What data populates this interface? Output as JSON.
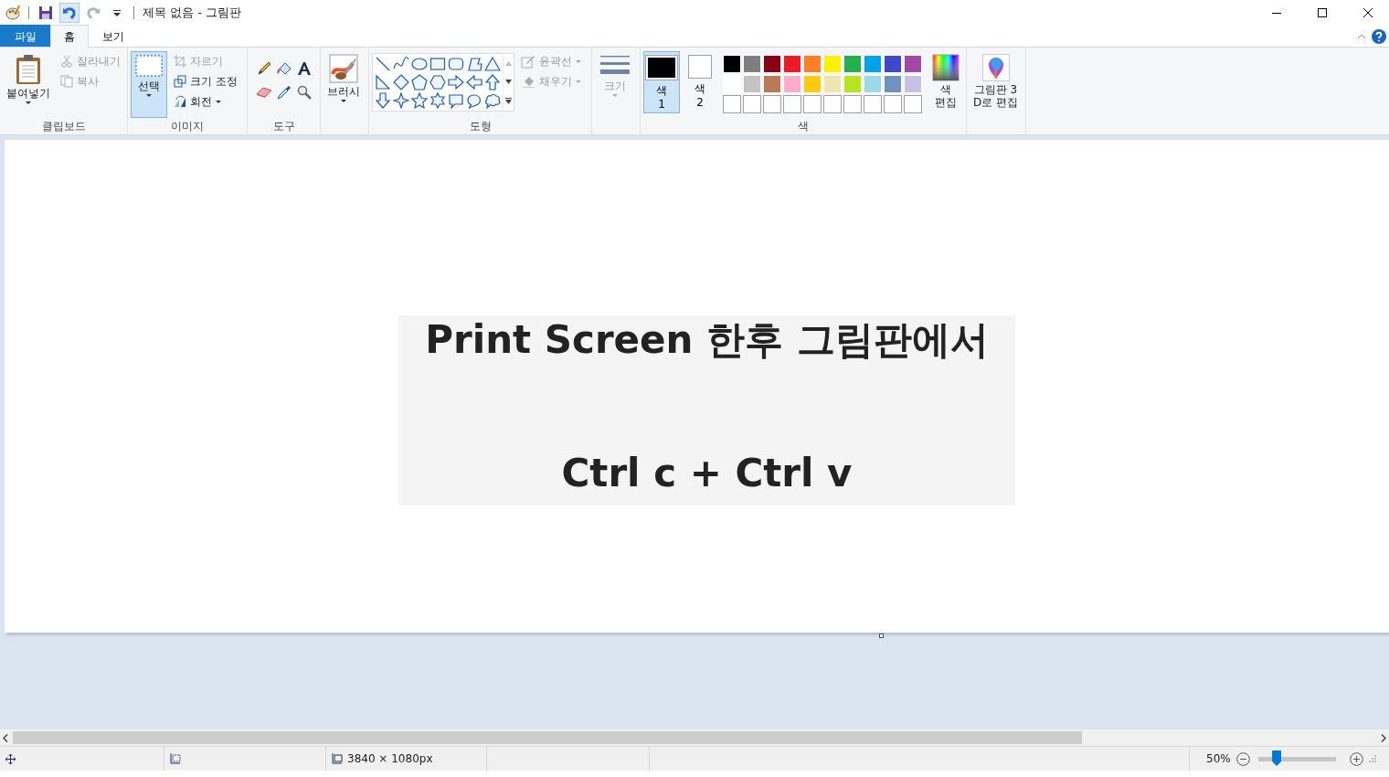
{
  "window": {
    "title": "제목 없음 - 그림판"
  },
  "tabs": [
    {
      "label": "파일",
      "kind": "file",
      "selected": false
    },
    {
      "label": "홈",
      "kind": "tab",
      "selected": true
    },
    {
      "label": "보기",
      "kind": "tab",
      "selected": false
    }
  ],
  "ribbon": {
    "clipboard": {
      "label": "클립보드",
      "paste": {
        "label": "붙여넣기"
      },
      "cut": {
        "label": "잘라내기",
        "disabled": true
      },
      "copy": {
        "label": "복사",
        "disabled": true
      }
    },
    "image": {
      "label": "이미지",
      "select": {
        "label": "선택",
        "selected": true
      },
      "crop": {
        "label": "자르기",
        "disabled": true
      },
      "resize": {
        "label": "크기 조정",
        "disabled": false
      },
      "rotate": {
        "label": "회전",
        "disabled": false
      }
    },
    "tools": {
      "label": "도구"
    },
    "brushes": {
      "label": "브러시"
    },
    "shapes": {
      "label": "도형",
      "outline": {
        "label": "윤곽선",
        "disabled": true
      },
      "fill": {
        "label": "채우기",
        "disabled": true
      }
    },
    "size": {
      "label": "크기",
      "disabled": true
    },
    "colors": {
      "label": "색",
      "color1": {
        "lines": [
          "색",
          "1"
        ],
        "color": "#000000",
        "selected": true
      },
      "color2": {
        "lines": [
          "색",
          "2"
        ],
        "color": "#ffffff",
        "selected": false
      },
      "palette": [
        {
          "color": "#000000"
        },
        {
          "color": "#7f7f7f"
        },
        {
          "color": "#880015"
        },
        {
          "color": "#ed1c24"
        },
        {
          "color": "#ff7f27"
        },
        {
          "color": "#fff200"
        },
        {
          "color": "#22b14c"
        },
        {
          "color": "#00a2e8"
        },
        {
          "color": "#3f48cc"
        },
        {
          "color": "#a349a4"
        },
        {
          "color": "#ffffff"
        },
        {
          "color": "#c3c3c3"
        },
        {
          "color": "#b97a57"
        },
        {
          "color": "#ffaec9"
        },
        {
          "color": "#ffc90e"
        },
        {
          "color": "#efe4b0"
        },
        {
          "color": "#b5e61d"
        },
        {
          "color": "#99d9ea"
        },
        {
          "color": "#7092be"
        },
        {
          "color": "#c8bfe7"
        }
      ],
      "edit": {
        "lines": [
          "색",
          "편집"
        ]
      }
    },
    "paint3d": {
      "lines": [
        "그림판 3",
        "D로 편집"
      ]
    }
  },
  "canvas": {
    "lines": [
      "Print Screen 한후 그림판에서",
      "Ctrl c + Ctrl v"
    ]
  },
  "status_bar": {
    "dimensions": "3840 × 1080px",
    "zoom": "50%",
    "zoom_slider": {
      "level": 0.24
    }
  }
}
